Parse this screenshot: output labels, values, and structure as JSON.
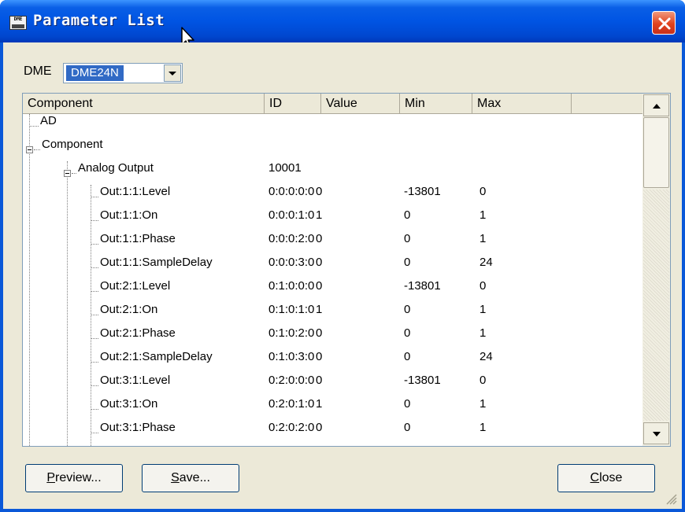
{
  "window": {
    "title": "Parameter List",
    "app_icon_text": "DME",
    "close_icon": "close-icon"
  },
  "dme": {
    "label": "DME",
    "selected": "DME24N"
  },
  "columns": [
    "Component",
    "ID",
    "Value",
    "Min",
    "Max",
    ""
  ],
  "tree": [
    {
      "label": "AD",
      "id": "",
      "value": "",
      "min": "",
      "max": ""
    },
    {
      "label": "Component",
      "id": "",
      "value": "",
      "min": "",
      "max": ""
    },
    {
      "label": "Analog Output",
      "id": "10001",
      "value": "",
      "min": "",
      "max": ""
    },
    {
      "label": "Out:1:1:Level",
      "id": "0:0:0:0:0",
      "value": "0",
      "min": "-13801",
      "max": "0"
    },
    {
      "label": "Out:1:1:On",
      "id": "0:0:0:1:0",
      "value": "1",
      "min": "0",
      "max": "1"
    },
    {
      "label": "Out:1:1:Phase",
      "id": "0:0:0:2:0",
      "value": "0",
      "min": "0",
      "max": "1"
    },
    {
      "label": "Out:1:1:SampleDelay",
      "id": "0:0:0:3:0",
      "value": "0",
      "min": "0",
      "max": "24"
    },
    {
      "label": "Out:2:1:Level",
      "id": "0:1:0:0:0",
      "value": "0",
      "min": "-13801",
      "max": "0"
    },
    {
      "label": "Out:2:1:On",
      "id": "0:1:0:1:0",
      "value": "1",
      "min": "0",
      "max": "1"
    },
    {
      "label": "Out:2:1:Phase",
      "id": "0:1:0:2:0",
      "value": "0",
      "min": "0",
      "max": "1"
    },
    {
      "label": "Out:2:1:SampleDelay",
      "id": "0:1:0:3:0",
      "value": "0",
      "min": "0",
      "max": "24"
    },
    {
      "label": "Out:3:1:Level",
      "id": "0:2:0:0:0",
      "value": "0",
      "min": "-13801",
      "max": "0"
    },
    {
      "label": "Out:3:1:On",
      "id": "0:2:0:1:0",
      "value": "1",
      "min": "0",
      "max": "1"
    },
    {
      "label": "Out:3:1:Phase",
      "id": "0:2:0:2:0",
      "value": "0",
      "min": "0",
      "max": "1"
    }
  ],
  "buttons": {
    "preview_mnemonic": "P",
    "preview_rest": "review...",
    "save_mnemonic": "S",
    "save_rest": "ave...",
    "close_mnemonic": "C",
    "close_rest": "lose"
  }
}
